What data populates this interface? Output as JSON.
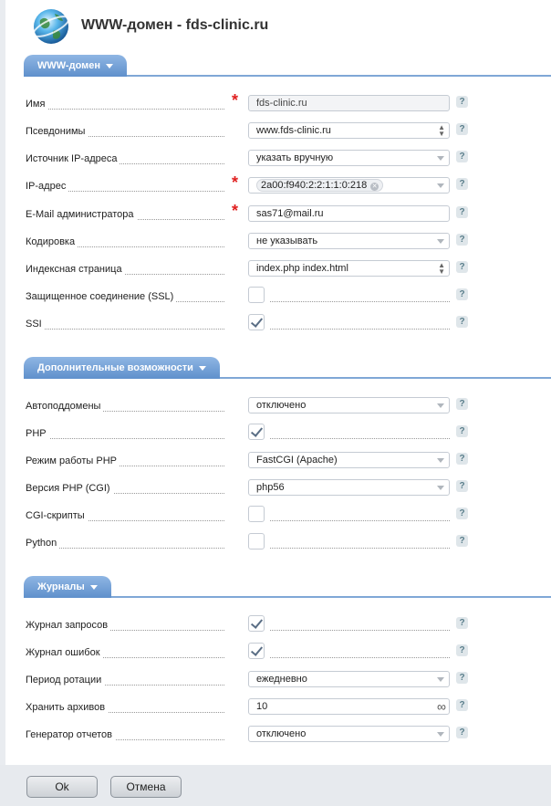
{
  "window_title": "WWW-домен - fds-clinic.ru",
  "sections": {
    "domain": {
      "title": "WWW-домен",
      "name_label": "Имя",
      "name_value": "fds-clinic.ru",
      "aliases_label": "Псевдонимы",
      "aliases_value": "www.fds-clinic.ru",
      "ip_source_label": "Источник IP-адреса",
      "ip_source_value": "указать вручную",
      "ip_label": "IP-адрес",
      "ip_value": "2a00:f940:2:2:1:1:0:218",
      "email_label": "E-Mail администратора",
      "email_value": "sas71@mail.ru",
      "charset_label": "Кодировка",
      "charset_value": "не указывать",
      "index_label": "Индексная страница",
      "index_value": "index.php index.html",
      "ssl_label": "Защищенное соединение (SSL)",
      "ssl_checked": false,
      "ssi_label": "SSI",
      "ssi_checked": true
    },
    "extra": {
      "title": "Дополнительные возможности",
      "autosub_label": "Автоподдомены",
      "autosub_value": "отключено",
      "php_label": "PHP",
      "php_checked": true,
      "php_mode_label": "Режим работы PHP",
      "php_mode_value": "FastCGI (Apache)",
      "php_version_label": "Версия PHP (CGI)",
      "php_version_value": "php56",
      "cgi_label": "CGI-скрипты",
      "cgi_checked": false,
      "python_label": "Python",
      "python_checked": false
    },
    "logs": {
      "title": "Журналы",
      "access_label": "Журнал запросов",
      "access_checked": true,
      "error_label": "Журнал ошибок",
      "error_checked": true,
      "rotation_label": "Период ротации",
      "rotation_value": "ежедневно",
      "archives_label": "Хранить архивов",
      "archives_value": "10",
      "reports_label": "Генератор отчетов",
      "reports_value": "отключено"
    }
  },
  "help_glyph": "?",
  "buttons": {
    "ok": "Ok",
    "cancel": "Отмена"
  },
  "colors": {
    "accent": "#6f9ed6",
    "required": "#e02020"
  }
}
